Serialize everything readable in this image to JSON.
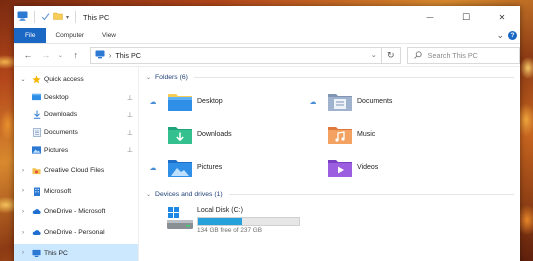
{
  "window": {
    "title": "This PC",
    "controls": {
      "minimize": "—",
      "maximize": "☐",
      "close": "✕"
    }
  },
  "ribbon": {
    "tabs": [
      "File",
      "Computer",
      "View"
    ],
    "expand": "⌄",
    "help": "?"
  },
  "address_bar": {
    "back": "←",
    "forward": "→",
    "recent": "⌄",
    "up": "↑",
    "separator": "›",
    "path": "This PC",
    "dropdown": "⌄",
    "refresh": "↻",
    "search_placeholder": "Search This PC"
  },
  "nav": {
    "items": [
      {
        "label": "Quick access",
        "icon": "star-icon",
        "expand": "⌄"
      },
      {
        "label": "Desktop",
        "icon": "desktop-folder-icon",
        "pin": "📌"
      },
      {
        "label": "Downloads",
        "icon": "download-icon",
        "pin": "📌"
      },
      {
        "label": "Documents",
        "icon": "documents-icon",
        "pin": "📌"
      },
      {
        "label": "Pictures",
        "icon": "pictures-icon",
        "pin": "📌"
      },
      {
        "label": "Creative Cloud Files",
        "icon": "creative-cloud-icon",
        "expand": "›"
      },
      {
        "label": "Microsoft",
        "icon": "building-icon",
        "expand": "›"
      },
      {
        "label": "OneDrive - Microsoft",
        "icon": "onedrive-icon",
        "expand": "›"
      },
      {
        "label": "OneDrive - Personal",
        "icon": "onedrive-icon",
        "expand": "›"
      },
      {
        "label": "This PC",
        "icon": "this-pc-icon",
        "expand": "›"
      }
    ]
  },
  "main": {
    "folders_header": "Folders (6)",
    "folders": [
      {
        "name": "Desktop",
        "icon": "desktop-folder-icon",
        "sync": "☁"
      },
      {
        "name": "Documents",
        "icon": "documents-folder-icon",
        "sync": "☁"
      },
      {
        "name": "Downloads",
        "icon": "downloads-folder-icon",
        "sync": ""
      },
      {
        "name": "Music",
        "icon": "music-folder-icon",
        "sync": ""
      },
      {
        "name": "Pictures",
        "icon": "pictures-folder-icon",
        "sync": "☁"
      },
      {
        "name": "Videos",
        "icon": "videos-folder-icon",
        "sync": ""
      }
    ],
    "devices_header": "Devices and drives (1)",
    "drive": {
      "name": "Local Disk (C:)",
      "free_text": "134 GB free of 237 GB",
      "used_fraction": 0.435,
      "bar_color": "#26a0da"
    }
  }
}
